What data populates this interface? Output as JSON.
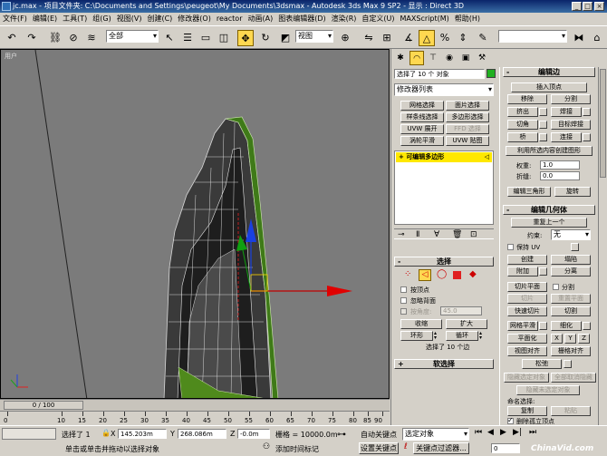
{
  "title": {
    "text": "jc.max - 项目文件夹: C:\\Documents and Settings\\peugeot\\My Documents\\3dsmax - Autodesk 3ds Max 9 SP2 - 显示 : Direct 3D",
    "min": "_",
    "max": "□",
    "close": "×"
  },
  "menu": [
    "文件(F)",
    "编辑(E)",
    "工具(T)",
    "组(G)",
    "视图(V)",
    "创建(C)",
    "修改器(O)",
    "reactor",
    "动画(A)",
    "图表编辑器(D)",
    "渲染(R)",
    "自定义(U)",
    "MAXScript(M)",
    "帮助(H)"
  ],
  "toolbar": {
    "filter": "全部",
    "refcoord": "视图"
  },
  "viewport": {
    "label": "用户"
  },
  "timeslider": "0 / 100",
  "trackbar": {
    "ticks": [
      "0",
      "10",
      "15",
      "20",
      "25",
      "30",
      "35",
      "40",
      "45",
      "50",
      "55",
      "60",
      "65",
      "70",
      "75",
      "80",
      "85",
      "90"
    ]
  },
  "cmdpanel": {
    "sel_count": "选择了 10 个 对象",
    "modlist": "修改器列表",
    "buttons": [
      "网格选择",
      "面片选择",
      "样条线选择",
      "多边形选择",
      "UVW 展开",
      "FFD 选择",
      "涡轮平滑",
      "UVW 贴图"
    ],
    "stack_item": "可编辑多边形",
    "selection_roll": "选择",
    "by_vertex": "按顶点",
    "ignore_back": "忽略背面",
    "by_angle": "按角度:",
    "angle_val": "45.0",
    "shrink": "收缩",
    "grow": "扩大",
    "ring": "环形",
    "loop": "循环",
    "sel_info": "选择了 10 个边",
    "soft_sel": "软选择"
  },
  "rpanel": {
    "edit_edges": "编辑边",
    "insert_vertex": "插入顶点",
    "remove": "移除",
    "split": "分割",
    "extrude": "挤出",
    "weld": "焊接",
    "chamfer": "切角",
    "target_weld": "目标焊接",
    "bridge": "桥",
    "connect": "连接",
    "create_shape": "利用所选内容创建图形",
    "weight": "权重:",
    "weight_val": "1.0",
    "crease": "折缝:",
    "crease_val": "0.0",
    "edit_tri": "编辑三角形",
    "turn": "旋转",
    "edit_geo": "编辑几何体",
    "repeat_last": "重复上一个",
    "constraint": "约束:",
    "constraint_val": "无",
    "preserve_uv": "保持 UV",
    "create": "创建",
    "collapse": "塌陷",
    "attach": "附加",
    "detach": "分离",
    "slice_plane": "切片平面",
    "split2": "分割",
    "slice": "切片",
    "reset_plane": "重置平面",
    "quickslice": "快速切片",
    "cut": "切割",
    "meshsmooth": "网格平滑",
    "tessellate": "细化",
    "make_planar": "平面化",
    "x": "X",
    "y": "Y",
    "z": "Z",
    "view_align": "视图对齐",
    "grid_align": "栅格对齐",
    "relax": "松弛",
    "hide_sel": "隐藏选定对象",
    "unhide_all": "全部取消隐藏",
    "hide_unsel": "隐藏未选定对象",
    "named_sel": "命名选择:",
    "copy": "复制",
    "paste": "粘贴",
    "delete_iso": "删除孤立顶点"
  },
  "status": {
    "sel": "选择了 1",
    "x_lbl": "X",
    "x": "145.203m",
    "y_lbl": "Y",
    "y": "268.086m",
    "z_lbl": "Z",
    "z": "-0.0m",
    "grid": "栅格 = 10000.0m",
    "autokey": "自动关键点",
    "setkey": "设置关键点",
    "keyfilter_sel": "选定对象",
    "keyfilter": "关键点过滤器...",
    "prompt": "单击或单击并拖动以选择对象",
    "addtag": "添加时间标记",
    "frame": "0",
    "watermark": "ChinaVid.com"
  }
}
